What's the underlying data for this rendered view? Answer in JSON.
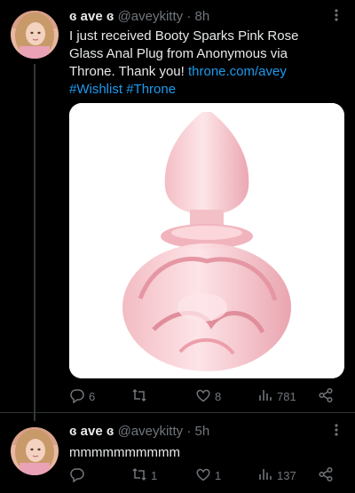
{
  "tweets": [
    {
      "display_name": "ɞ ave ɞ",
      "handle": "@aveykitty",
      "time": "8h",
      "text_before": "I just received Booty Sparks Pink Rose Glass Anal Plug from Anonymous via Throne. Thank you! ",
      "link_url": "throne.com/avey",
      "hashtag_1": "#Wishlist",
      "hashtag_2": "#Throne",
      "replies": "6",
      "retweets": "",
      "likes": "8",
      "views": "781"
    },
    {
      "display_name": "ɞ ave ɞ",
      "handle": "@aveykitty",
      "time": "5h",
      "text": "mmmmmmmmmm",
      "replies": "",
      "retweets": "1",
      "likes": "1",
      "views": "137"
    }
  ],
  "colors": {
    "background": "#000000",
    "text": "#e7e9ea",
    "muted": "#71767b",
    "link": "#1d9bf0",
    "divider": "#2f3336"
  },
  "icons": [
    "avatar",
    "more-icon",
    "reply-icon",
    "retweet-icon",
    "like-icon",
    "views-icon",
    "share-icon"
  ]
}
